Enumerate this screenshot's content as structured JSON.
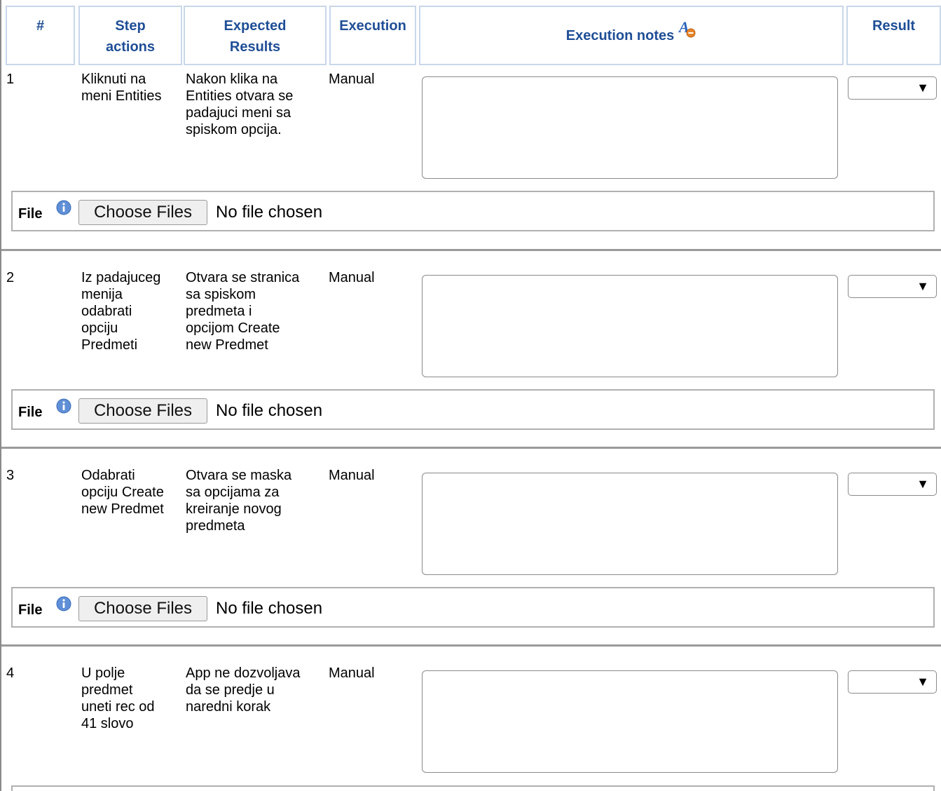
{
  "header": {
    "num": "#",
    "step_actions": "Step\nactions",
    "expected_results": "Expected\nResults",
    "execution": "Execution",
    "execution_notes": "Execution notes",
    "result": "Result",
    "notes_icon": "font-format-remove-icon"
  },
  "steps": [
    {
      "num": "1",
      "action": "Kliknuti na\nmeni Entities",
      "expected": "Nakon klika na\nEntities otvara se\npadajuci meni sa\nspiskom opcija.",
      "execution": "Manual",
      "notes": "",
      "result": ""
    },
    {
      "num": "2",
      "action": "Iz padajuceg\nmenija\nodabrati\nopciju\nPredmeti",
      "expected": "Otvara se stranica\nsa spiskom\npredmeta i\nopcijom Create\nnew Predmet",
      "execution": "Manual",
      "notes": "",
      "result": ""
    },
    {
      "num": "3",
      "action": "Odabrati\nopciju Create\nnew Predmet",
      "expected": "Otvara se maska\nsa opcijama za\nkreiranje novog\npredmeta",
      "execution": "Manual",
      "notes": "",
      "result": ""
    },
    {
      "num": "4",
      "action": "U polje\npredmet\nuneti rec od\n41 slovo",
      "expected": "App ne dozvoljava\nda se predje u\nnaredni korak",
      "execution": "Manual",
      "notes": "",
      "result": ""
    }
  ],
  "file": {
    "label": "File",
    "button": "Choose Files",
    "status": "No file chosen",
    "info_icon": "info-icon"
  },
  "colors": {
    "header_text": "#1f4e96",
    "header_border": "#c9d7ea"
  }
}
